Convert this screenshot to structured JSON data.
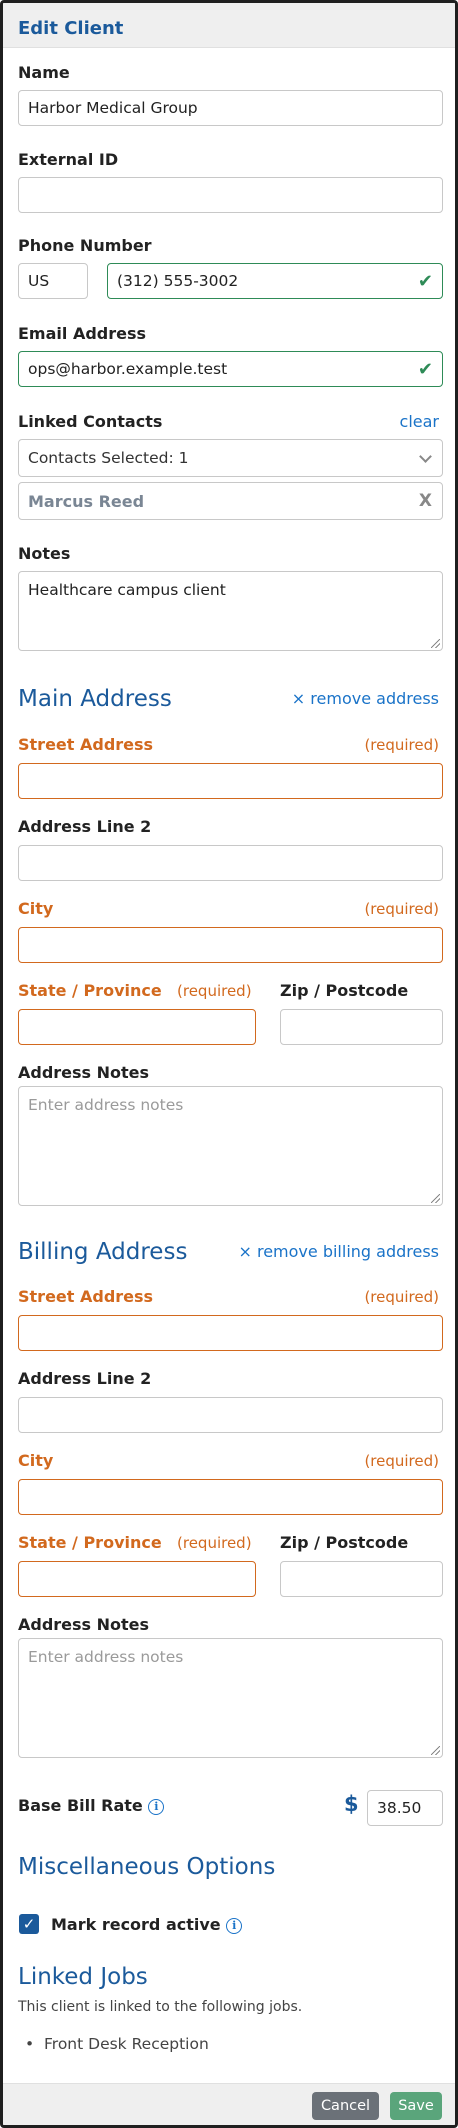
{
  "header": {
    "title": "Edit Client"
  },
  "name": {
    "label": "Name",
    "value": "Harbor Medical Group"
  },
  "external_id": {
    "label": "External ID",
    "value": ""
  },
  "phone": {
    "label": "Phone Number",
    "country": "US",
    "value": "(312) 555-3002"
  },
  "email": {
    "label": "Email Address",
    "value": "ops@harbor.example.test"
  },
  "linked_contacts": {
    "label": "Linked Contacts",
    "clear_label": "clear",
    "select_text": "Contacts Selected: 1",
    "chips": [
      "Marcus Reed"
    ],
    "remove_label": "X"
  },
  "notes": {
    "label": "Notes",
    "value": "Healthcare campus client"
  },
  "main_address": {
    "title": "Main Address",
    "remove_label": "× remove address",
    "street_label": "Street Address",
    "required_label": "(required)",
    "line2_label": "Address Line 2",
    "city_label": "City",
    "state_label": "State / Province",
    "zip_label": "Zip / Postcode",
    "notes_label": "Address Notes",
    "notes_placeholder": "Enter address notes"
  },
  "billing_address": {
    "title": "Billing Address",
    "remove_label": "× remove billing address",
    "street_label": "Street Address",
    "required_label": "(required)",
    "line2_label": "Address Line 2",
    "city_label": "City",
    "state_label": "State / Province",
    "zip_label": "Zip / Postcode",
    "notes_label": "Address Notes",
    "notes_placeholder": "Enter address notes"
  },
  "bill_rate": {
    "label": "Base Bill Rate",
    "currency": "$",
    "value": "38.50",
    "info_icon": "i"
  },
  "misc": {
    "title": "Miscellaneous Options",
    "active_label": "Mark record active",
    "active_checked": true,
    "info_icon": "i"
  },
  "linked_jobs": {
    "title": "Linked Jobs",
    "description": "This client is linked to the following jobs.",
    "items": [
      "Front Desk Reception"
    ]
  },
  "footer": {
    "cancel_label": "Cancel",
    "save_label": "Save"
  },
  "colors": {
    "accent": "#1b5a9b",
    "required": "#d2691e",
    "valid": "#2e8b57",
    "link": "#1a73c8"
  }
}
